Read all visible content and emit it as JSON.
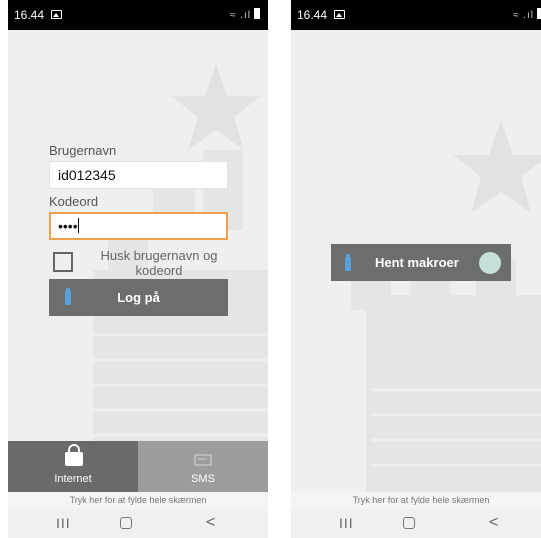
{
  "status_bar": {
    "time": "16.44",
    "icons": "≈ .ıl"
  },
  "login": {
    "username_label": "Brugernavn",
    "username_value": "id012345",
    "password_label": "Kodeord",
    "password_value": "••••",
    "remember_label": "Husk brugernavn og kodeord",
    "remember_checked": false,
    "login_button": "Log på"
  },
  "tabs": [
    {
      "label": "Internet",
      "selected": true
    },
    {
      "label": "SMS",
      "selected": false
    }
  ],
  "macro": {
    "button_label": "Hent makroer"
  },
  "hint_text": "Tryk her for at fylde hele skærmen",
  "nav": {
    "recent": "III",
    "back": "<"
  },
  "colors": {
    "button_bg": "#6c6d6d",
    "focus_border": "#f0a04b",
    "tab_selected": "#6a6a6a",
    "tab_unselected": "#9c9c9c"
  }
}
